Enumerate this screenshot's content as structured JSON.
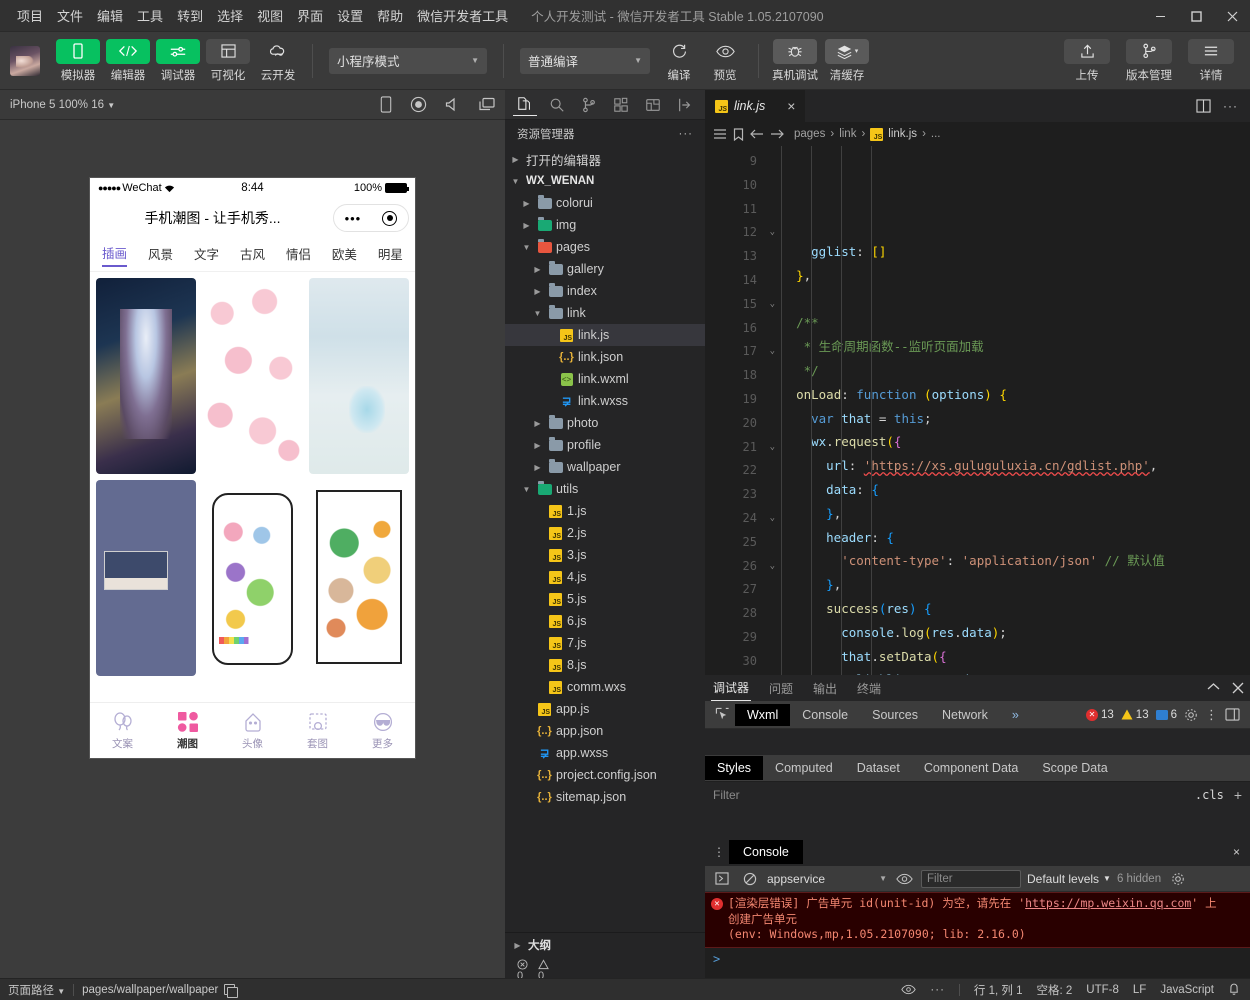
{
  "titlebar": {
    "menus": [
      "项目",
      "文件",
      "编辑",
      "工具",
      "转到",
      "选择",
      "视图",
      "界面",
      "设置",
      "帮助",
      "微信开发者工具"
    ],
    "window_title": "个人开发测试 - 微信开发者工具 Stable 1.05.2107090",
    "minimize": "minimize-icon",
    "maximize": "maximize-icon",
    "close": "close-icon"
  },
  "toolbar": {
    "buttons": [
      {
        "label": "模拟器",
        "icon": "phone-icon",
        "style": "green"
      },
      {
        "label": "编辑器",
        "icon": "code-icon",
        "style": "green"
      },
      {
        "label": "调试器",
        "icon": "sliders-icon",
        "style": "green"
      },
      {
        "label": "可视化",
        "icon": "layout-icon",
        "style": "gray"
      },
      {
        "label": "云开发",
        "icon": "cloud-icon",
        "style": "gray"
      }
    ],
    "mode_select": "小程序模式",
    "compile_select": "普通编译",
    "actions": [
      {
        "label": "编译",
        "icon": "refresh-icon"
      },
      {
        "label": "预览",
        "icon": "eye-icon"
      },
      {
        "label": "真机调试",
        "icon": "bug-icon"
      },
      {
        "label": "清缓存",
        "icon": "layers-icon"
      }
    ],
    "right_buttons": [
      {
        "label": "上传",
        "icon": "upload-icon"
      },
      {
        "label": "版本管理",
        "icon": "branch-icon"
      },
      {
        "label": "详情",
        "icon": "menu-icon"
      }
    ]
  },
  "simulator": {
    "device_label": "iPhone 5 100% 16",
    "tool_icons": [
      "phone-rotate-icon",
      "record-icon",
      "volume-icon",
      "screen-cast-icon"
    ],
    "phone": {
      "carrier": "WeChat",
      "signal_dots": "●●●●●",
      "time": "8:44",
      "battery_pct": "100%",
      "nav_title": "手机潮图 - 让手机秀...",
      "capsule_dots": "•••",
      "categories": [
        "插画",
        "风景",
        "文字",
        "古风",
        "情侣",
        "欧美",
        "明星"
      ],
      "active_category": "插画",
      "gallery_cells": [
        "anime-girl",
        "pink-pattern",
        "soft-blue",
        "dark-photo-collage",
        "doodle-stickers",
        "frog-cat-stickers"
      ],
      "tabbar": [
        {
          "label": "文案",
          "icon": "balloon-icon"
        },
        {
          "label": "潮图",
          "icon": "grid-icon"
        },
        {
          "label": "头像",
          "icon": "ghost-icon"
        },
        {
          "label": "套图",
          "icon": "album-icon"
        },
        {
          "label": "更多",
          "icon": "sunglasses-icon"
        }
      ],
      "active_tab": "潮图"
    }
  },
  "explorer": {
    "activity_icons": [
      "files-icon",
      "search-icon",
      "source-control-icon",
      "extensions-icon",
      "debug-icon",
      "login-icon"
    ],
    "title": "资源管理器",
    "more": "···",
    "sections": [
      "打开的编辑器",
      "WX_WENAN"
    ],
    "tree": [
      {
        "label": "打开的编辑器",
        "type": "section",
        "indent": 0,
        "arrow": "right"
      },
      {
        "label": "WX_WENAN",
        "type": "root",
        "indent": 0,
        "arrow": "down"
      },
      {
        "label": "colorui",
        "type": "folder",
        "indent": 1,
        "arrow": "right"
      },
      {
        "label": "img",
        "type": "folder-green",
        "indent": 1,
        "arrow": "right"
      },
      {
        "label": "pages",
        "type": "folder-red",
        "indent": 1,
        "arrow": "down"
      },
      {
        "label": "gallery",
        "type": "folder",
        "indent": 2,
        "arrow": "right"
      },
      {
        "label": "index",
        "type": "folder",
        "indent": 2,
        "arrow": "right"
      },
      {
        "label": "link",
        "type": "folder-open",
        "indent": 2,
        "arrow": "down"
      },
      {
        "label": "link.js",
        "type": "js",
        "indent": 3,
        "arrow": "none",
        "selected": true
      },
      {
        "label": "link.json",
        "type": "json",
        "indent": 3,
        "arrow": "none"
      },
      {
        "label": "link.wxml",
        "type": "wxml",
        "indent": 3,
        "arrow": "none"
      },
      {
        "label": "link.wxss",
        "type": "wxss",
        "indent": 3,
        "arrow": "none"
      },
      {
        "label": "photo",
        "type": "folder",
        "indent": 2,
        "arrow": "right"
      },
      {
        "label": "profile",
        "type": "folder",
        "indent": 2,
        "arrow": "right"
      },
      {
        "label": "wallpaper",
        "type": "folder",
        "indent": 2,
        "arrow": "right"
      },
      {
        "label": "utils",
        "type": "folder-green",
        "indent": 1,
        "arrow": "down"
      },
      {
        "label": "1.js",
        "type": "js",
        "indent": 2,
        "arrow": "none"
      },
      {
        "label": "2.js",
        "type": "js",
        "indent": 2,
        "arrow": "none"
      },
      {
        "label": "3.js",
        "type": "js",
        "indent": 2,
        "arrow": "none"
      },
      {
        "label": "4.js",
        "type": "js",
        "indent": 2,
        "arrow": "none"
      },
      {
        "label": "5.js",
        "type": "js",
        "indent": 2,
        "arrow": "none"
      },
      {
        "label": "6.js",
        "type": "js",
        "indent": 2,
        "arrow": "none"
      },
      {
        "label": "7.js",
        "type": "js",
        "indent": 2,
        "arrow": "none"
      },
      {
        "label": "8.js",
        "type": "js",
        "indent": 2,
        "arrow": "none"
      },
      {
        "label": "comm.wxs",
        "type": "js",
        "indent": 2,
        "arrow": "none"
      },
      {
        "label": "app.js",
        "type": "js",
        "indent": 1,
        "arrow": "none"
      },
      {
        "label": "app.json",
        "type": "json",
        "indent": 1,
        "arrow": "none"
      },
      {
        "label": "app.wxss",
        "type": "wxss",
        "indent": 1,
        "arrow": "none"
      },
      {
        "label": "project.config.json",
        "type": "json",
        "indent": 1,
        "arrow": "none"
      },
      {
        "label": "sitemap.json",
        "type": "json",
        "indent": 1,
        "arrow": "none"
      }
    ],
    "outline": {
      "title": "大纲",
      "errors": "0",
      "warnings": "0"
    }
  },
  "editor": {
    "tab": {
      "name": "link.js",
      "icon": "js-file-icon",
      "close": "×"
    },
    "tab_actions": [
      "split-editor-icon",
      "more-actions-icon"
    ],
    "breadcrumb": [
      "pages",
      "link",
      "link.js",
      "..."
    ],
    "breadcrumb_icons": [
      "list-icon",
      "bookmark-icon",
      "back-arrow-icon",
      "forward-arrow-icon"
    ],
    "lines": [
      {
        "no": "9",
        "fold": "",
        "html": "    <span class=\"tok-prop\">gglist</span><span class=\"tok-pun\">:</span> <span class=\"tok-brk\">[]</span>"
      },
      {
        "no": "10",
        "fold": "",
        "html": "  <span class=\"tok-brk\">}</span><span class=\"tok-pun\">,</span>"
      },
      {
        "no": "11",
        "fold": "",
        "html": ""
      },
      {
        "no": "12",
        "fold": "v",
        "html": "  <span class=\"tok-cmt\">/**</span>"
      },
      {
        "no": "13",
        "fold": "",
        "html": "   <span class=\"tok-cmt\">* 生命周期函数--监听页面加载</span>"
      },
      {
        "no": "14",
        "fold": "",
        "html": "   <span class=\"tok-cmt\">*/</span>"
      },
      {
        "no": "15",
        "fold": "v",
        "html": "  <span class=\"tok-fn\">onLoad</span><span class=\"tok-pun\">:</span> <span class=\"tok-key\">function</span> <span class=\"tok-brk\">(</span><span class=\"tok-var\">options</span><span class=\"tok-brk\">)</span> <span class=\"tok-brk\">{</span>"
      },
      {
        "no": "16",
        "fold": "",
        "html": "    <span class=\"tok-key\">var</span> <span class=\"tok-var\">that</span> <span class=\"tok-pun\">=</span> <span class=\"tok-this\">this</span><span class=\"tok-pun\">;</span>"
      },
      {
        "no": "17",
        "fold": "v",
        "html": "    <span class=\"tok-prop\">wx</span><span class=\"tok-pun\">.</span><span class=\"tok-fn\">request</span><span class=\"tok-brk\">(</span><span class=\"tok-brk2\">{</span>"
      },
      {
        "no": "18",
        "fold": "",
        "html": "      <span class=\"tok-prop\">url</span><span class=\"tok-pun\">:</span> <span class=\"tok-str err-underline\">'https://xs.guluguluxia.cn/gdlist.php'</span><span class=\"tok-pun\">,</span>"
      },
      {
        "no": "19",
        "fold": "",
        "html": "      <span class=\"tok-prop\">data</span><span class=\"tok-pun\">:</span> <span class=\"tok-brk3\">{</span>"
      },
      {
        "no": "20",
        "fold": "",
        "html": "      <span class=\"tok-brk3\">}</span><span class=\"tok-pun\">,</span>"
      },
      {
        "no": "21",
        "fold": "v",
        "html": "      <span class=\"tok-prop\">header</span><span class=\"tok-pun\">:</span> <span class=\"tok-brk3\">{</span>"
      },
      {
        "no": "22",
        "fold": "",
        "html": "        <span class=\"tok-str\">'content-type'</span><span class=\"tok-pun\">:</span> <span class=\"tok-str\">'application/json'</span> <span class=\"tok-cmt\">// 默认值</span>"
      },
      {
        "no": "23",
        "fold": "",
        "html": "      <span class=\"tok-brk3\">}</span><span class=\"tok-pun\">,</span>"
      },
      {
        "no": "24",
        "fold": "v",
        "html": "      <span class=\"tok-fn\">success</span><span class=\"tok-brk3\">(</span><span class=\"tok-var\">res</span><span class=\"tok-brk3\">)</span> <span class=\"tok-brk3\">{</span>"
      },
      {
        "no": "25",
        "fold": "",
        "html": "        <span class=\"tok-prop\">console</span><span class=\"tok-pun\">.</span><span class=\"tok-fn\">log</span><span class=\"tok-brk\">(</span><span class=\"tok-prop\">res</span><span class=\"tok-pun\">.</span><span class=\"tok-prop\">data</span><span class=\"tok-brk\">)</span><span class=\"tok-pun\">;</span>"
      },
      {
        "no": "26",
        "fold": "v",
        "html": "        <span class=\"tok-prop\">that</span><span class=\"tok-pun\">.</span><span class=\"tok-fn\">setData</span><span class=\"tok-brk\">(</span><span class=\"tok-brk2\">{</span>"
      },
      {
        "no": "27",
        "fold": "",
        "html": "          <span class=\"tok-prop\">linklist</span><span class=\"tok-pun\">:</span> <span class=\"tok-prop\">res</span><span class=\"tok-pun\">.</span><span class=\"tok-prop\">data</span>"
      },
      {
        "no": "28",
        "fold": "",
        "html": "        <span class=\"tok-brk2\">}</span><span class=\"tok-brk\">)</span><span class=\"tok-pun\">;</span>"
      },
      {
        "no": "29",
        "fold": "",
        "html": "      <span class=\"tok-brk3\">}</span>"
      },
      {
        "no": "30",
        "fold": "",
        "html": "    <span class=\"tok-brk2\">}</span><span class=\"tok-brk\">)</span>"
      }
    ]
  },
  "debugger": {
    "panel_tabs": [
      "调试器",
      "问题",
      "输出",
      "终端"
    ],
    "active_panel_tab": "调试器",
    "panel_actions": [
      "collapse-icon",
      "close-icon"
    ],
    "devtools_tabs": [
      "Wxml",
      "Console",
      "Sources",
      "Network"
    ],
    "active_devtools_tab": "Wxml",
    "overflow": "»",
    "counts": {
      "errors": "13",
      "warnings": "13",
      "info": "6"
    },
    "right_icons": [
      "settings-gear-icon",
      "kebab-menu-icon",
      "dock-side-icon"
    ],
    "style_tabs": [
      "Styles",
      "Computed",
      "Dataset",
      "Component Data",
      "Scope Data"
    ],
    "active_style_tab": "Styles",
    "filter_placeholder": "Filter",
    "cls_label": ".cls",
    "plus_label": "+"
  },
  "console": {
    "tab_label": "Console",
    "close": "×",
    "context": "appservice",
    "filter_placeholder": "Filter",
    "levels": "Default levels",
    "hidden": "6 hidden",
    "toolbar_icons": [
      "execute-icon",
      "clear-console-icon",
      "eye-icon",
      "console-settings-icon"
    ],
    "error": {
      "line1_a": "[渲染层错误] 广告单元 id(unit-id) 为空，请先在 '",
      "link": "https://mp.weixin.qq.com",
      "line1_b": "' 上",
      "line2": "创建广告单元",
      "line3": "(env: Windows,mp,1.05.2107090; lib: 2.16.0)"
    },
    "prompt": ">"
  },
  "statusbar": {
    "page_path_label": "页面路径",
    "page_path": "pages/wallpaper/wallpaper",
    "copy_icon": "copy-icon",
    "eye_icon": "eye-icon",
    "more_icon": "more-icon",
    "cursor": "行 1, 列 1",
    "spaces": "空格: 2",
    "encoding": "UTF-8",
    "eol": "LF",
    "language": "JavaScript",
    "bell_icon": "bell-icon"
  },
  "colors": {
    "accent_green": "#07c160",
    "error_red": "#e02f2f",
    "warning_yellow": "#f5c518",
    "editor_bg": "#1e1e1e",
    "panel_bg": "#252526",
    "chrome_bg": "#3a3a3a"
  }
}
